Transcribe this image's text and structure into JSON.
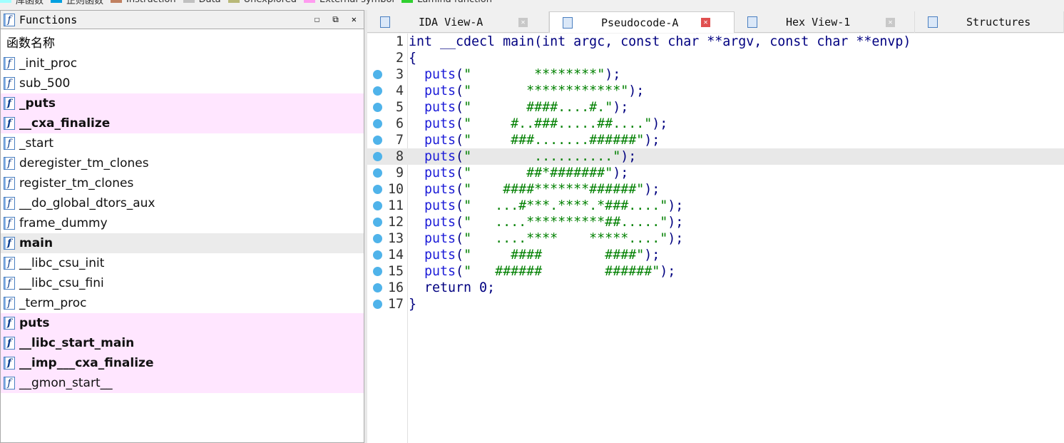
{
  "legend": [
    {
      "label": "库函数",
      "color": "#a0ffff"
    },
    {
      "label": "正则函数",
      "color": "#00a0e0"
    },
    {
      "label": "Instruction",
      "color": "#c08060"
    },
    {
      "label": "Data",
      "color": "#c0c0c0"
    },
    {
      "label": "Unexplored",
      "color": "#b8b878"
    },
    {
      "label": "External symbol",
      "color": "#ff9cf0"
    },
    {
      "label": "Lumina function",
      "color": "#30d030"
    }
  ],
  "functions_panel": {
    "title": "Functions",
    "column_header": "函数名称",
    "items": [
      {
        "name": "_init_proc",
        "type": "regular"
      },
      {
        "name": "sub_500",
        "type": "regular"
      },
      {
        "name": "_puts",
        "type": "library"
      },
      {
        "name": "__cxa_finalize",
        "type": "library"
      },
      {
        "name": "_start",
        "type": "regular"
      },
      {
        "name": "deregister_tm_clones",
        "type": "regular"
      },
      {
        "name": "register_tm_clones",
        "type": "regular"
      },
      {
        "name": "__do_global_dtors_aux",
        "type": "regular"
      },
      {
        "name": "frame_dummy",
        "type": "regular"
      },
      {
        "name": "main",
        "type": "selected"
      },
      {
        "name": "__libc_csu_init",
        "type": "regular"
      },
      {
        "name": "__libc_csu_fini",
        "type": "regular"
      },
      {
        "name": "_term_proc",
        "type": "regular"
      },
      {
        "name": "puts",
        "type": "library"
      },
      {
        "name": "__libc_start_main",
        "type": "library"
      },
      {
        "name": "__imp___cxa_finalize",
        "type": "library"
      },
      {
        "name": "__gmon_start__",
        "type": "external"
      }
    ]
  },
  "tabs": [
    {
      "label": "IDA View-A",
      "active": false
    },
    {
      "label": "Pseudocode-A",
      "active": true
    },
    {
      "label": "Hex View-1",
      "active": false
    },
    {
      "label": "Structures",
      "active": false
    }
  ],
  "code": {
    "highlighted_line": 8,
    "lines": [
      {
        "n": "1",
        "text": "int __cdecl main(int argc, const char **argv, const char **envp)",
        "bp": false
      },
      {
        "n": "2",
        "text": "{",
        "bp": false
      },
      {
        "n": "3",
        "call": "puts",
        "str": "        ********",
        "bp": true
      },
      {
        "n": "4",
        "call": "puts",
        "str": "       ************",
        "bp": true
      },
      {
        "n": "5",
        "call": "puts",
        "str": "       ####....#.",
        "bp": true
      },
      {
        "n": "6",
        "call": "puts",
        "str": "     #..###.....##....",
        "bp": true
      },
      {
        "n": "7",
        "call": "puts",
        "str": "     ###.......######",
        "bp": true
      },
      {
        "n": "8",
        "call": "puts",
        "str": "        ..........",
        "bp": true
      },
      {
        "n": "9",
        "call": "puts",
        "str": "       ##*#######",
        "bp": true
      },
      {
        "n": "10",
        "call": "puts",
        "str": "    ####*******######",
        "bp": true
      },
      {
        "n": "11",
        "call": "puts",
        "str": "   ...#***.****.*###....",
        "bp": true
      },
      {
        "n": "12",
        "call": "puts",
        "str": "   ....**********##.....",
        "bp": true
      },
      {
        "n": "13",
        "call": "puts",
        "str": "   ....****    *****....",
        "bp": true
      },
      {
        "n": "14",
        "call": "puts",
        "str": "     ####        ####",
        "bp": true
      },
      {
        "n": "15",
        "call": "puts",
        "str": "   ######        ######",
        "bp": true
      },
      {
        "n": "16",
        "text": "  return 0;",
        "bp": true
      },
      {
        "n": "17",
        "text": "}",
        "bp": true
      }
    ]
  }
}
